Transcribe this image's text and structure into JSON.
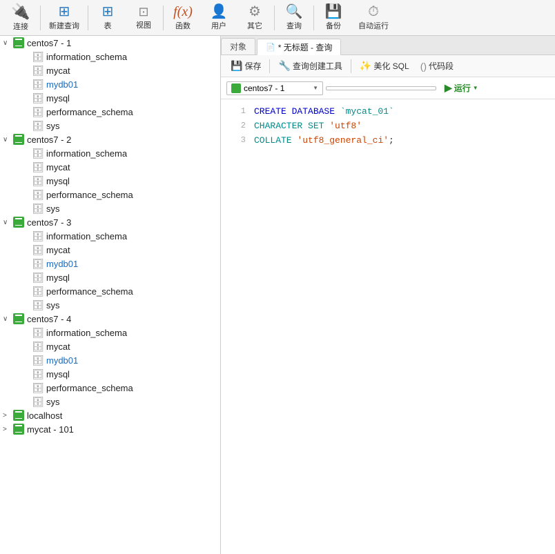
{
  "toolbar": {
    "items": [
      {
        "id": "connect",
        "label": "连接",
        "icon": "🔌",
        "class": "connect"
      },
      {
        "id": "new-query",
        "label": "新建查询",
        "icon": "📄",
        "class": "new-query"
      },
      {
        "id": "table",
        "label": "表",
        "icon": "🗂",
        "class": "table-icon"
      },
      {
        "id": "view",
        "label": "视图",
        "icon": "👁",
        "class": "view-icon"
      },
      {
        "id": "function",
        "label": "函数",
        "icon": "ƒ",
        "class": "func-icon"
      },
      {
        "id": "user",
        "label": "用户",
        "icon": "👤",
        "class": "user-icon"
      },
      {
        "id": "other",
        "label": "其它",
        "icon": "⚙",
        "class": "other-icon"
      },
      {
        "id": "query",
        "label": "查询",
        "icon": "🔍",
        "class": "query-icon"
      },
      {
        "id": "backup",
        "label": "备份",
        "icon": "💾",
        "class": "backup-icon"
      },
      {
        "id": "auto",
        "label": "自动运行",
        "icon": "▶",
        "class": "auto-icon"
      }
    ]
  },
  "sidebar": {
    "servers": [
      {
        "id": "centos7-1",
        "label": "centos7 - 1",
        "expanded": true,
        "databases": [
          {
            "name": "information_schema",
            "blue": false
          },
          {
            "name": "mycat",
            "blue": false
          },
          {
            "name": "mydb01",
            "blue": true
          },
          {
            "name": "mysql",
            "blue": false
          },
          {
            "name": "performance_schema",
            "blue": false
          },
          {
            "name": "sys",
            "blue": false
          }
        ]
      },
      {
        "id": "centos7-2",
        "label": "centos7 - 2",
        "expanded": true,
        "databases": [
          {
            "name": "information_schema",
            "blue": false
          },
          {
            "name": "mycat",
            "blue": false
          },
          {
            "name": "mysql",
            "blue": false
          },
          {
            "name": "performance_schema",
            "blue": false
          },
          {
            "name": "sys",
            "blue": false
          }
        ]
      },
      {
        "id": "centos7-3",
        "label": "centos7 - 3",
        "expanded": true,
        "databases": [
          {
            "name": "information_schema",
            "blue": false
          },
          {
            "name": "mycat",
            "blue": false
          },
          {
            "name": "mydb01",
            "blue": true
          },
          {
            "name": "mysql",
            "blue": false
          },
          {
            "name": "performance_schema",
            "blue": false
          },
          {
            "name": "sys",
            "blue": false
          }
        ]
      },
      {
        "id": "centos7-4",
        "label": "centos7 - 4",
        "expanded": true,
        "databases": [
          {
            "name": "information_schema",
            "blue": false
          },
          {
            "name": "mycat",
            "blue": false
          },
          {
            "name": "mydb01",
            "blue": true
          },
          {
            "name": "mysql",
            "blue": false
          },
          {
            "name": "performance_schema",
            "blue": false
          },
          {
            "name": "sys",
            "blue": false
          }
        ]
      },
      {
        "id": "localhost",
        "label": "localhost",
        "expanded": false,
        "databases": []
      },
      {
        "id": "mycat-101",
        "label": "mycat - 101",
        "expanded": false,
        "databases": []
      }
    ]
  },
  "tabs": {
    "object_tab": "对象",
    "query_tab": "* 无标题 - 查询"
  },
  "query_toolbar": {
    "save": "保存",
    "build": "查询创建工具",
    "beautify": "美化 SQL",
    "snippet": "代码段"
  },
  "conn_bar": {
    "server": "centos7 - 1",
    "db_placeholder": "",
    "run_label": "运行"
  },
  "code": {
    "lines": [
      {
        "num": "1",
        "tokens": [
          {
            "text": "CREATE DATABASE ",
            "class": "kw-blue"
          },
          {
            "text": "`mycat_01`",
            "class": "identifier"
          }
        ]
      },
      {
        "num": "2",
        "tokens": [
          {
            "text": "CHARACTER SET ",
            "class": "kw-cyan"
          },
          {
            "text": "'utf8'",
            "class": "str-orange"
          }
        ]
      },
      {
        "num": "3",
        "tokens": [
          {
            "text": "COLLATE ",
            "class": "kw-cyan"
          },
          {
            "text": "'utf8_general_ci'",
            "class": "str-orange"
          },
          {
            "text": ";",
            "class": "punct"
          }
        ]
      }
    ]
  }
}
